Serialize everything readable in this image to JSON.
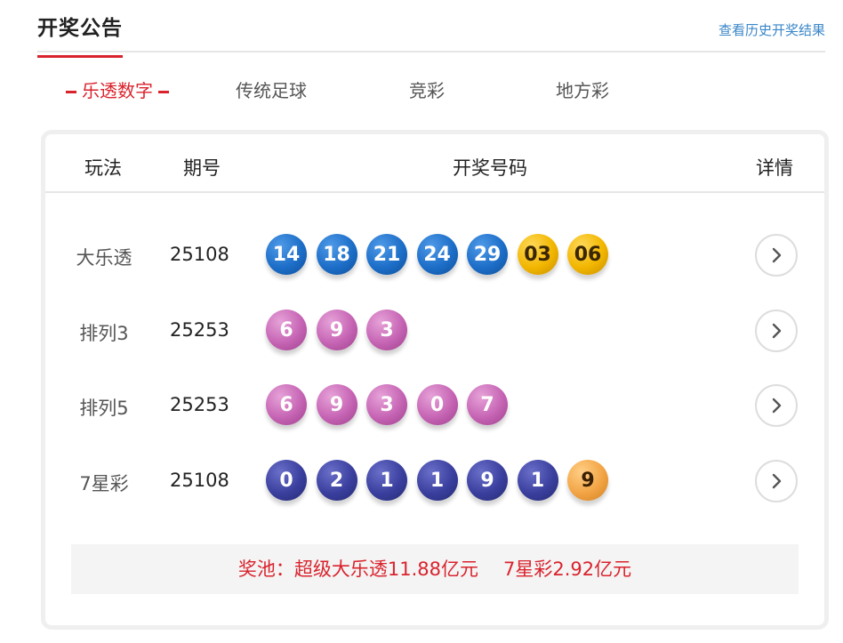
{
  "header": {
    "title": "开奖公告",
    "history_link": "查看历史开奖结果"
  },
  "tabs": [
    {
      "label": "乐透数字",
      "active": true
    },
    {
      "label": "传统足球",
      "active": false
    },
    {
      "label": "竞彩",
      "active": false
    },
    {
      "label": "地方彩",
      "active": false
    }
  ],
  "table": {
    "columns": {
      "play": "玩法",
      "issue": "期号",
      "numbers": "开奖号码",
      "detail": "详情"
    },
    "rows": [
      {
        "name": "大乐透",
        "issue": "25108",
        "balls": [
          {
            "n": "14",
            "color": "blue"
          },
          {
            "n": "18",
            "color": "blue"
          },
          {
            "n": "21",
            "color": "blue"
          },
          {
            "n": "24",
            "color": "blue"
          },
          {
            "n": "29",
            "color": "blue"
          },
          {
            "n": "03",
            "color": "gold"
          },
          {
            "n": "06",
            "color": "gold"
          }
        ]
      },
      {
        "name": "排列3",
        "issue": "25253",
        "balls": [
          {
            "n": "6",
            "color": "pink"
          },
          {
            "n": "9",
            "color": "pink"
          },
          {
            "n": "3",
            "color": "pink"
          }
        ]
      },
      {
        "name": "排列5",
        "issue": "25253",
        "balls": [
          {
            "n": "6",
            "color": "pink"
          },
          {
            "n": "9",
            "color": "pink"
          },
          {
            "n": "3",
            "color": "pink"
          },
          {
            "n": "0",
            "color": "pink"
          },
          {
            "n": "7",
            "color": "pink"
          }
        ]
      },
      {
        "name": "7星彩",
        "issue": "25108",
        "balls": [
          {
            "n": "0",
            "color": "navy"
          },
          {
            "n": "2",
            "color": "navy"
          },
          {
            "n": "1",
            "color": "navy"
          },
          {
            "n": "1",
            "color": "navy"
          },
          {
            "n": "9",
            "color": "navy"
          },
          {
            "n": "1",
            "color": "navy"
          },
          {
            "n": "9",
            "color": "orange"
          }
        ]
      }
    ]
  },
  "pool": {
    "daletou": "奖池：超级大乐透11.88亿元",
    "qixingcai": "7星彩2.92亿元"
  },
  "colors": {
    "accent": "#d9232d",
    "link": "#3a86c8"
  },
  "icons": {
    "detail": "chevron-right-icon"
  }
}
